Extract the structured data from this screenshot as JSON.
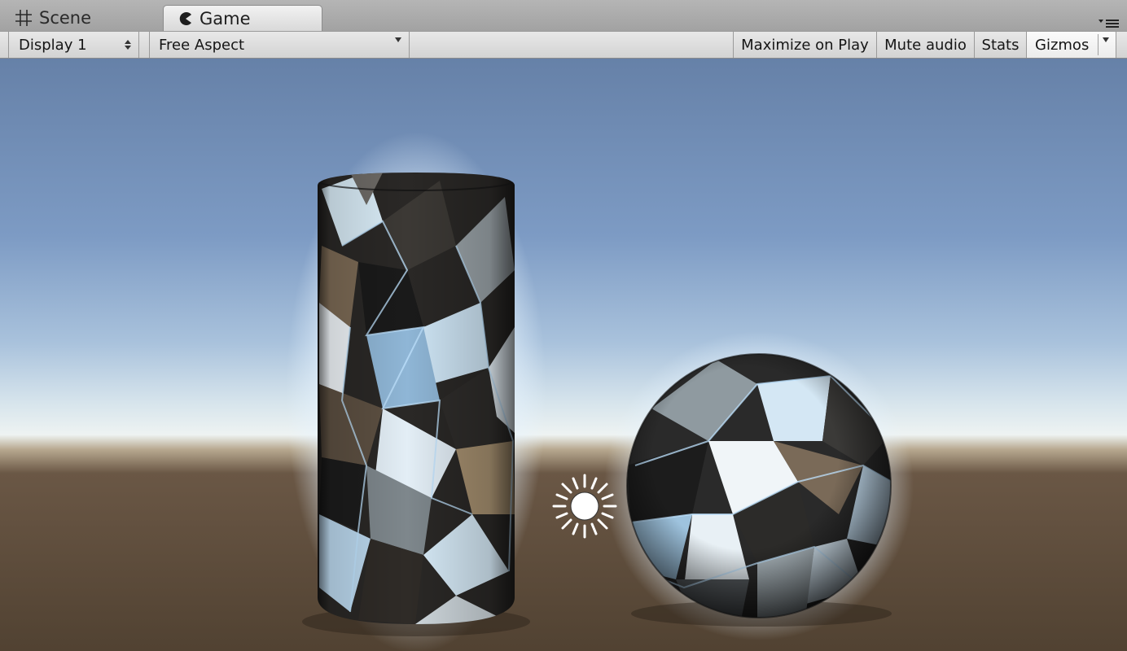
{
  "tabs": {
    "scene": {
      "label": "Scene",
      "icon": "scene-grid-icon"
    },
    "game": {
      "label": "Game",
      "icon": "game-pacman-icon",
      "active": true
    },
    "menu_icon": "panel-menu-icon"
  },
  "toolbar": {
    "display": {
      "label": "Display 1",
      "icon": "up-down-arrows-icon"
    },
    "aspect": {
      "label": "Free Aspect",
      "icon": "dropdown-arrow-icon"
    },
    "maximize_label": "Maximize on Play",
    "mute_label": "Mute audio",
    "stats_label": "Stats",
    "gizmos": {
      "label": "Gizmos",
      "icon": "dropdown-arrow-icon"
    }
  },
  "scene": {
    "objects": [
      "crystal-cylinder",
      "crystal-sphere",
      "directional-light-icon"
    ],
    "colors": {
      "sky_top": "#6a86ad",
      "sky_horizon": "#dde8ee",
      "ground": "#5a4a3a",
      "crystal_light": "#bfe3ff",
      "crystal_dark": "#1d1d1d"
    }
  }
}
